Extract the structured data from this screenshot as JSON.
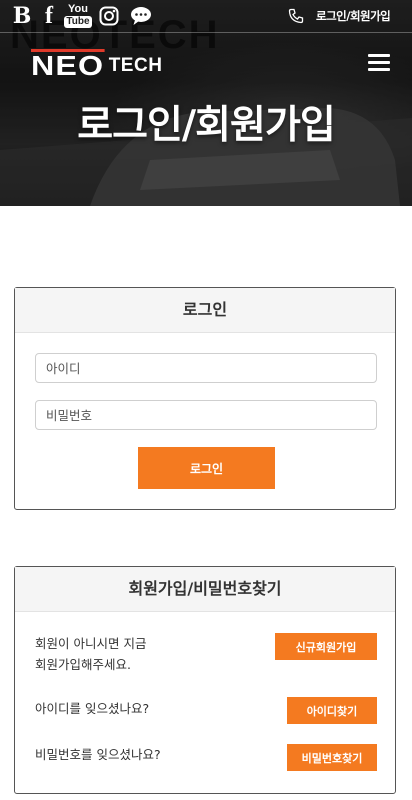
{
  "header": {
    "social_icons": [
      "blog-icon",
      "facebook-icon",
      "youtube-icon",
      "instagram-icon",
      "kakaotalk-icon"
    ],
    "blog_glyph": "B",
    "facebook_glyph": "f",
    "youtube_top": "You",
    "youtube_bottom": "Tube",
    "login_link": "로그인/회원가입",
    "logo_main": "NEO",
    "logo_sub": "TECH",
    "menu_icon": "hamburger-menu-icon"
  },
  "hero": {
    "title": "로그인/회원가입"
  },
  "login": {
    "title": "로그인",
    "id_placeholder": "아이디",
    "pw_placeholder": "비밀번호",
    "button": "로그인"
  },
  "join": {
    "title": "회원가입/비밀번호찾기",
    "signup_text_line1": "회원이 아니시면 지금",
    "signup_text_line2": "회원가입해주세요.",
    "signup_button": "신규회원가입",
    "find_id_text": "아이디를 잊으셨나요?",
    "find_id_button": "아이디찾기",
    "find_pw_text": "비밀번호를 잊으셨나요?",
    "find_pw_button": "비밀번호찾기"
  },
  "colors": {
    "accent": "#f47a20",
    "card_header_bg": "#f5f5f5",
    "card_border": "#555555"
  }
}
